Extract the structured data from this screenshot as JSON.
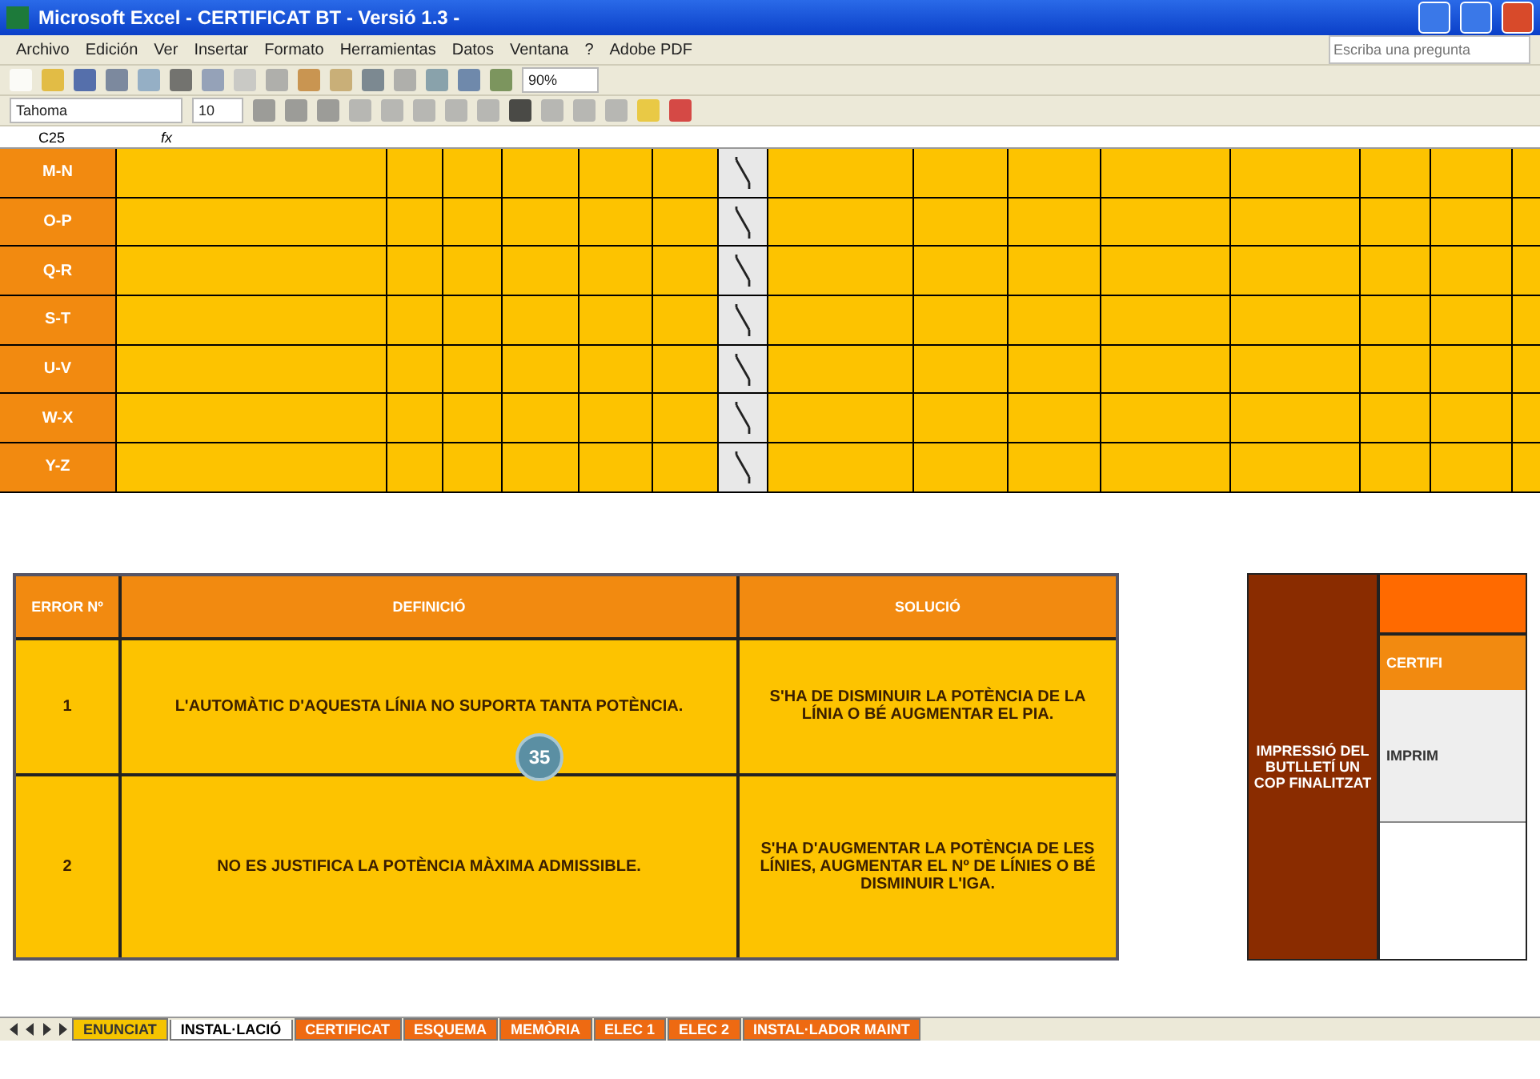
{
  "window": {
    "title": "Microsoft Excel - CERTIFICAT BT - Versió 1.3 -"
  },
  "menu": [
    "Archivo",
    "Edición",
    "Ver",
    "Insertar",
    "Formato",
    "Herramientas",
    "Datos",
    "Ventana",
    "?",
    "Adobe PDF"
  ],
  "help_search": {
    "placeholder": "Escriba una pregunta"
  },
  "toolbar": {
    "zoom": "90%"
  },
  "format_bar": {
    "font": "Tahoma",
    "size": "10"
  },
  "formula_bar": {
    "cell": "C25",
    "fx": "fx"
  },
  "grid": {
    "rows": [
      {
        "label": "M-N"
      },
      {
        "label": "O-P"
      },
      {
        "label": "Q-R"
      },
      {
        "label": "S-T"
      },
      {
        "label": "U-V"
      },
      {
        "label": "W-X"
      },
      {
        "label": "Y-Z"
      }
    ]
  },
  "errors_table": {
    "columns": [
      "ERROR Nº",
      "DEFINICIÓ",
      "SOLUCIÓ"
    ],
    "rows": [
      {
        "number": "1",
        "definition": "L'AUTOMÀTIC D'AQUESTA LÍNIA NO SUPORTA TANTA POTÈNCIA.",
        "solution": "S'HA DE DISMINUIR LA POTÈNCIA DE LA LÍNIA O BÉ AUGMENTAR EL PIA."
      },
      {
        "number": "2",
        "definition": "NO ES JUSTIFICA LA POTÈNCIA MÀXIMA ADMISSIBLE.",
        "solution": "S'HA D'AUGMENTAR LA POTÈNCIA DE LES LÍNIES, AUGMENTAR EL Nº DE LÍNIES O BÉ DISMINUIR L'IGA."
      }
    ]
  },
  "page_badge": "35",
  "print_panel": {
    "note": "IMPRESSIÓ DEL BUTLLETÍ UN COP FINALITZAT",
    "header": "CERTIFI",
    "action": "IMPRIM"
  },
  "sheet_tabs": [
    {
      "label": "ENUNCIAT",
      "selected": false,
      "color": "#f5c400"
    },
    {
      "label": "INSTAL·LACIÓ",
      "selected": true,
      "color": "#ffffff"
    },
    {
      "label": "CERTIFICAT",
      "selected": false,
      "color": "#ee6a12"
    },
    {
      "label": "ESQUEMA",
      "selected": false,
      "color": "#ee6a12"
    },
    {
      "label": "MEMÒRIA",
      "selected": false,
      "color": "#ee6a12"
    },
    {
      "label": "ELEC 1",
      "selected": false,
      "color": "#ee6a12"
    },
    {
      "label": "ELEC 2",
      "selected": false,
      "color": "#ee6a12"
    },
    {
      "label": "INSTAL·LADOR MAINT",
      "selected": false,
      "color": "#ee6a12"
    }
  ]
}
